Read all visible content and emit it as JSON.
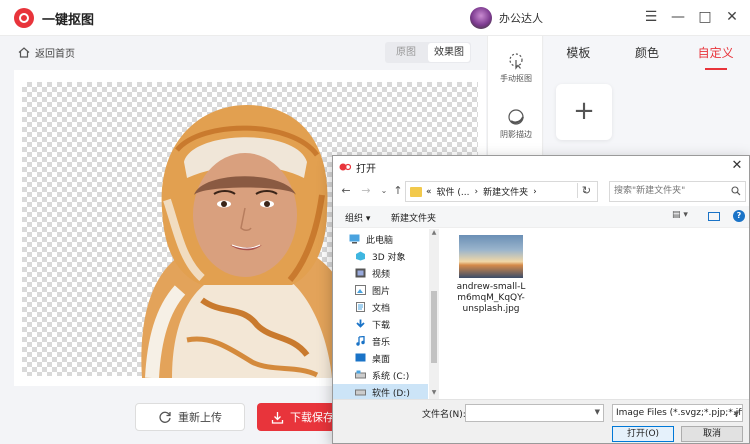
{
  "app": {
    "name": "一键抠图"
  },
  "user": {
    "name": "办公达人"
  },
  "window_controls": {
    "menu": "☰",
    "minimize": "—",
    "maximize": "□",
    "close": "✕"
  },
  "editor": {
    "back_label": "返回首页",
    "view_original": "原图",
    "view_result": "效果图",
    "reupload_label": "重新上传",
    "download_label": "下载保存"
  },
  "tools": [
    {
      "label": "手动抠图",
      "icon": "cursor-icon"
    },
    {
      "label": "阴影描边",
      "icon": "shadow-icon"
    }
  ],
  "right_panel": {
    "tabs": [
      "模板",
      "颜色",
      "自定义"
    ],
    "active_tab": "自定义",
    "add_symbol": "+"
  },
  "dialog": {
    "title": "打开",
    "address": [
      "«",
      "软件 (...",
      "›",
      "新建文件夹",
      "›"
    ],
    "search_placeholder": "搜索\"新建文件夹\"",
    "organize": "组织 ▾",
    "new_folder": "新建文件夹",
    "help": "?",
    "nav_items": [
      {
        "label": "此电脑",
        "icon": "computer-icon"
      },
      {
        "label": "3D 对象",
        "icon": "cube-icon"
      },
      {
        "label": "视频",
        "icon": "video-icon"
      },
      {
        "label": "图片",
        "icon": "picture-icon"
      },
      {
        "label": "文档",
        "icon": "document-icon"
      },
      {
        "label": "下载",
        "icon": "download-icon"
      },
      {
        "label": "音乐",
        "icon": "music-icon"
      },
      {
        "label": "桌面",
        "icon": "desktop-icon"
      },
      {
        "label": "系统 (C:)",
        "icon": "drive-icon"
      },
      {
        "label": "软件 (D:)",
        "icon": "drive-icon",
        "selected": true
      }
    ],
    "file": {
      "name": "andrew-small-L m6mqM_KqQY-unsplash.jpg"
    },
    "filename_label": "文件名(N):",
    "filename_value": "",
    "filetype": "Image Files (*.svgz;*.pjp;*.jfif",
    "open_label": "打开(O)",
    "cancel_label": "取消"
  },
  "colors": {
    "accent": "#e8343b",
    "selection": "#cce4f7",
    "primary_border": "#0078d7"
  }
}
